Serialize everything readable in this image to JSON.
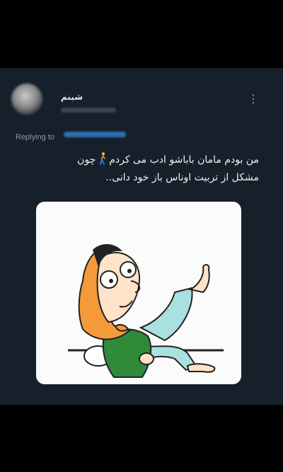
{
  "tweet": {
    "display_name": "شبنم",
    "reply_label": "Replying to",
    "text_line1_a": "من بودم مامان باباشو ادب می کردم",
    "text_line1_b": "چون",
    "text_line2": "مشکل از تربیت اوناس باز خود دانی..",
    "more_icon": "⋮"
  },
  "colors": {
    "page_background": "#000000",
    "card_background": "#15202b",
    "text_primary": "#e7e9ea",
    "text_secondary": "#8b98a5",
    "link": "#1d9bf0"
  },
  "icons": [
    "more-icon",
    "person-walking-icon"
  ]
}
